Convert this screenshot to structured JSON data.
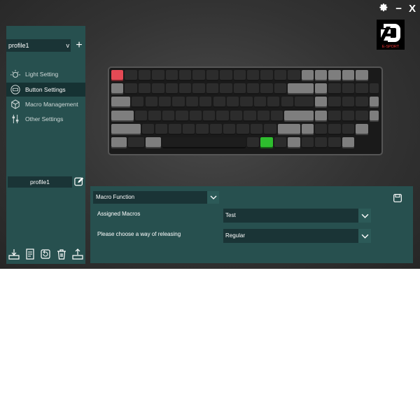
{
  "window": {
    "settings_icon": "gear-icon",
    "minimize_label": "−",
    "close_label": "X"
  },
  "sidebar": {
    "profile_select": "profile1",
    "profile_select_chevron": "v",
    "add_profile_label": "+",
    "items": [
      {
        "label": "Light Setting",
        "icon": "light-bulb-icon",
        "active": false
      },
      {
        "label": "Button Settings",
        "icon": "keyboard-icon",
        "active": true
      },
      {
        "label": "Macro Management",
        "icon": "cube-icon",
        "active": false
      },
      {
        "label": "Other Settings",
        "icon": "sliders-icon",
        "active": false
      }
    ],
    "profile_name": "profile1",
    "bottom_icons": [
      "import-icon",
      "notes-icon",
      "reset-icon",
      "trash-icon",
      "export-icon"
    ]
  },
  "brand": {
    "logo_text": "E-SPORT"
  },
  "panel": {
    "function_select": "Macro Function",
    "assigned_label": "Assigned Macros",
    "assigned_value": "Test",
    "release_label": "Please choose a way of releasing",
    "release_value": "Regular"
  },
  "colors": {
    "panel": "#27504f",
    "field": "#1a3436",
    "active": "#163233",
    "key_green": "#2ebd2e",
    "key_red": "#e54a55"
  }
}
